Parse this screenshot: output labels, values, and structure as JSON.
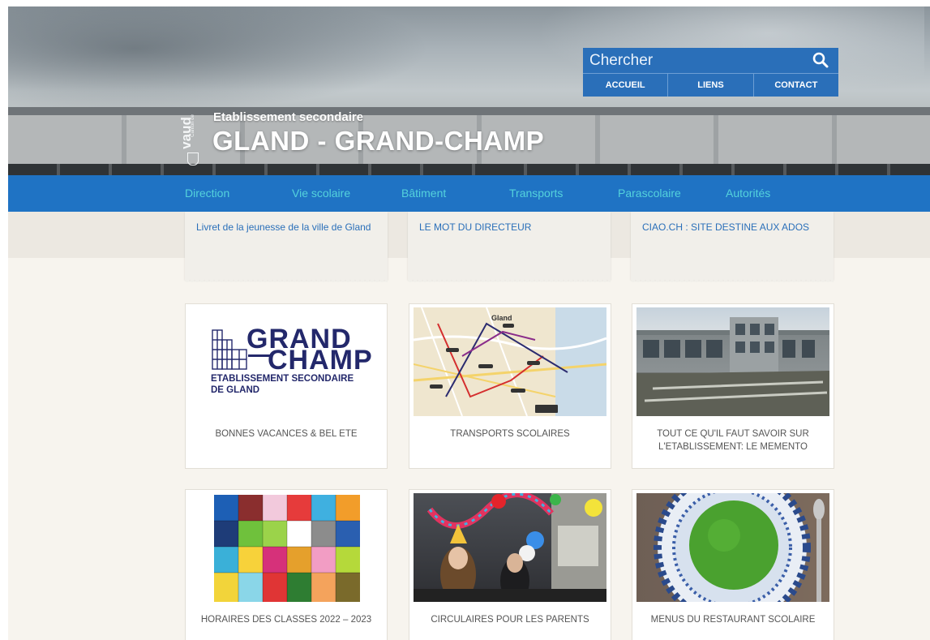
{
  "header": {
    "canton_label": "Canton de",
    "canton_name": "vaud",
    "subtitle": "Etablissement secondaire",
    "title": "GLAND - GRAND-CHAMP"
  },
  "search": {
    "placeholder": "Chercher"
  },
  "toplinks": [
    "ACCUEIL",
    "LIENS",
    "CONTACT"
  ],
  "mainnav": [
    "Direction",
    "Vie scolaire",
    "Bâtiment",
    "Transports",
    "Parascolaire",
    "Autorités"
  ],
  "teasers": [
    "Livret de la jeunesse de la ville de Gland",
    "LE MOT DU DIRECTEUR",
    "CIAO.CH : SITE DESTINE AUX ADOS"
  ],
  "cards": [
    {
      "caption": "BONNES VACANCES & BEL ETE"
    },
    {
      "caption": "TRANSPORTS SCOLAIRES"
    },
    {
      "caption": "TOUT CE QU'IL FAUT SAVOIR SUR L'ETABLISSEMENT: LE MEMENTO"
    },
    {
      "caption": "HORAIRES DES CLASSES 2022 – 2023"
    },
    {
      "caption": "CIRCULAIRES POUR LES PARENTS"
    },
    {
      "caption": "MENUS DU RESTAURANT SCOLAIRE"
    }
  ],
  "logo": {
    "line1": "GRAND",
    "line2": "CHAMP",
    "line3": "ETABLISSEMENT SECONDAIRE",
    "line4": "DE GLAND"
  },
  "map_label": "Gland",
  "colors": {
    "nav_bg": "#1f73c4",
    "nav_text": "#54d2dc",
    "link": "#2a6fb9",
    "logo_navy": "#23286b"
  }
}
